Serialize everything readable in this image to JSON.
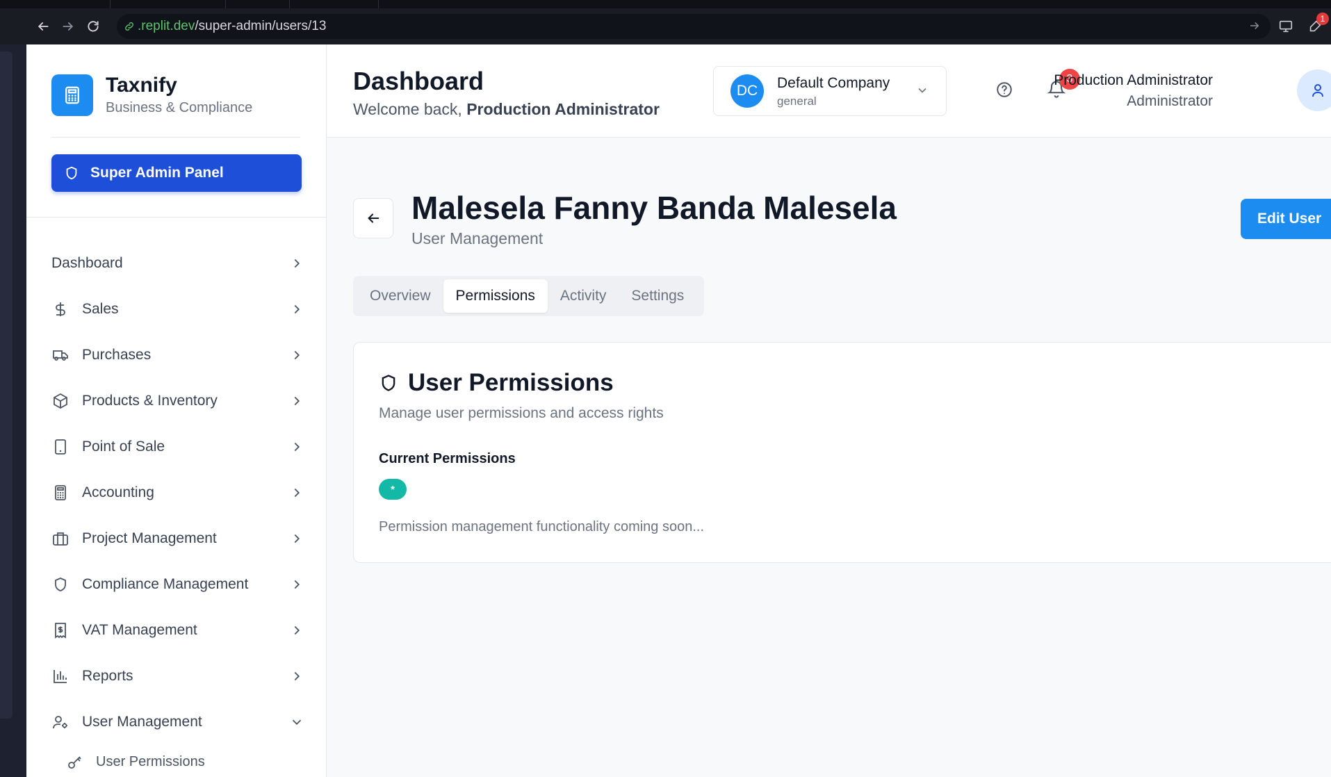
{
  "browser": {
    "url_domain": ".replit.dev",
    "url_path": "/super-admin/users/13",
    "extension_badge": "1"
  },
  "brand": {
    "name": "Taxnify",
    "subtitle": "Business & Compliance"
  },
  "sidebar": {
    "admin_button": "Super Admin Panel",
    "items": [
      {
        "label": "Dashboard",
        "icon": "none"
      },
      {
        "label": "Sales",
        "icon": "dollar-icon"
      },
      {
        "label": "Purchases",
        "icon": "truck-icon"
      },
      {
        "label": "Products & Inventory",
        "icon": "package-icon"
      },
      {
        "label": "Point of Sale",
        "icon": "tablet-icon"
      },
      {
        "label": "Accounting",
        "icon": "calculator-icon"
      },
      {
        "label": "Project Management",
        "icon": "briefcase-icon"
      },
      {
        "label": "Compliance Management",
        "icon": "shield-icon"
      },
      {
        "label": "VAT Management",
        "icon": "receipt-icon"
      },
      {
        "label": "Reports",
        "icon": "bar-chart-icon"
      },
      {
        "label": "User Management",
        "icon": "user-cog-icon"
      }
    ],
    "subitem": "User Permissions"
  },
  "header": {
    "title": "Dashboard",
    "welcome_prefix": "Welcome back,",
    "welcome_name": "Production Administrator",
    "company_initials": "DC",
    "company_name": "Default Company",
    "company_type": "general",
    "notification_count": "3",
    "user_name": "Production Administrator",
    "user_role": "Administrator"
  },
  "main": {
    "title": "Malesela Fanny Banda Malesela",
    "subtitle": "User Management",
    "edit_button": "Edit User",
    "tabs": [
      "Overview",
      "Permissions",
      "Activity",
      "Settings"
    ],
    "active_tab": "Permissions",
    "card": {
      "title": "User Permissions",
      "subtitle": "Manage user permissions and access rights",
      "current_label": "Current Permissions",
      "permission_badge": "*",
      "coming_soon": "Permission management functionality coming soon..."
    }
  }
}
